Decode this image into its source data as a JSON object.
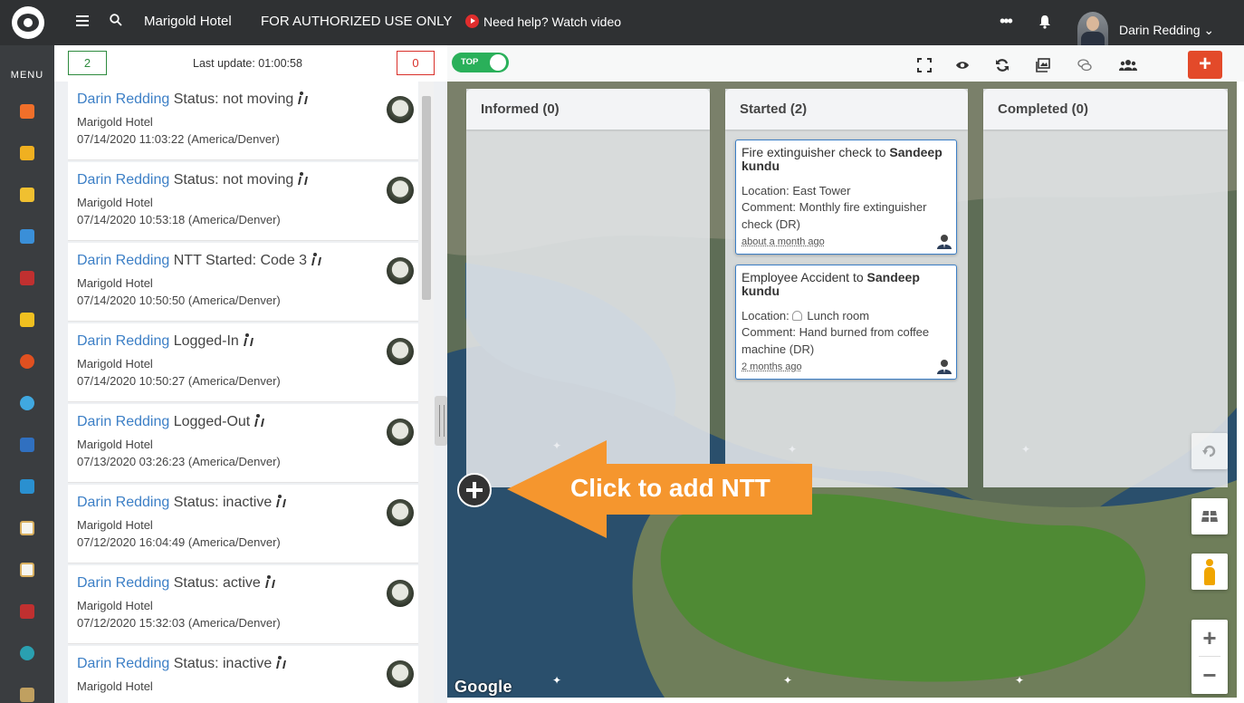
{
  "header": {
    "hotel": "Marigold Hotel",
    "notice": "FOR AUTHORIZED USE ONLY",
    "help": "Need help? Watch video",
    "more": "•••",
    "user": "Darin Redding ⌄"
  },
  "sidebar": {
    "menu_label": "MENU",
    "icons": [
      "home-icon",
      "shield-icon",
      "pencil-icon",
      "book-icon",
      "guard-icon",
      "hardhat-icon",
      "lifebuoy-icon",
      "atom-icon",
      "person-icon",
      "globe-icon",
      "clipboard-icon",
      "clipboard-alt-icon",
      "guard-alt-icon",
      "target-icon",
      "badge-icon"
    ]
  },
  "feed": {
    "count_left": "2",
    "last_update": "Last update: 01:00:58",
    "count_right": "0",
    "items": [
      {
        "who": "Darin Redding",
        "event": "Status: not moving",
        "place": "Marigold Hotel",
        "time": "07/14/2020 11:03:22 (America/Denver)"
      },
      {
        "who": "Darin Redding",
        "event": "Status: not moving",
        "place": "Marigold Hotel",
        "time": "07/14/2020 10:53:18 (America/Denver)"
      },
      {
        "who": "Darin Redding",
        "event": "NTT Started: Code 3",
        "place": "Marigold Hotel",
        "time": "07/14/2020 10:50:50 (America/Denver)"
      },
      {
        "who": "Darin Redding",
        "event": "Logged-In",
        "place": "Marigold Hotel",
        "time": "07/14/2020 10:50:27 (America/Denver)"
      },
      {
        "who": "Darin Redding",
        "event": "Logged-Out",
        "place": "Marigold Hotel",
        "time": "07/13/2020 03:26:23 (America/Denver)"
      },
      {
        "who": "Darin Redding",
        "event": "Status: inactive",
        "place": "Marigold Hotel",
        "time": "07/12/2020 16:04:49 (America/Denver)"
      },
      {
        "who": "Darin Redding",
        "event": "Status: active",
        "place": "Marigold Hotel",
        "time": "07/12/2020 15:32:03 (America/Denver)"
      },
      {
        "who": "Darin Redding",
        "event": "Status: inactive",
        "place": "Marigold Hotel",
        "time": ""
      }
    ]
  },
  "toolbar": {
    "toggle_label": "TOP",
    "add_label": "+"
  },
  "board": {
    "columns": [
      {
        "title": "Informed (0)"
      },
      {
        "title": "Started (2)"
      },
      {
        "title": "Completed (0)"
      }
    ],
    "cards": [
      {
        "title_pre": "Fire extinguisher check to ",
        "assignee": "Sandeep kundu",
        "location": "Location: East Tower",
        "comment": "Comment: Monthly fire extinguisher check (DR)",
        "time": "about a month ago"
      },
      {
        "title_pre": "Employee Accident to ",
        "assignee": "Sandeep kundu",
        "location": "Location:",
        "location_value": "Lunch room",
        "comment": "Comment: Hand burned from coffee machine (DR)",
        "time": "2 months ago"
      }
    ]
  },
  "callout": {
    "text": "Click to add NTT"
  },
  "map": {
    "brand": "Google",
    "zoom_in": "+",
    "zoom_out": "−"
  },
  "colors": {
    "accent_blue": "#3c7fc6",
    "add_red": "#e34a2a",
    "toggle_green": "#2ab05a",
    "callout_orange": "#f5962e",
    "counter_green": "#2e8b3e",
    "counter_red": "#d9302a"
  }
}
